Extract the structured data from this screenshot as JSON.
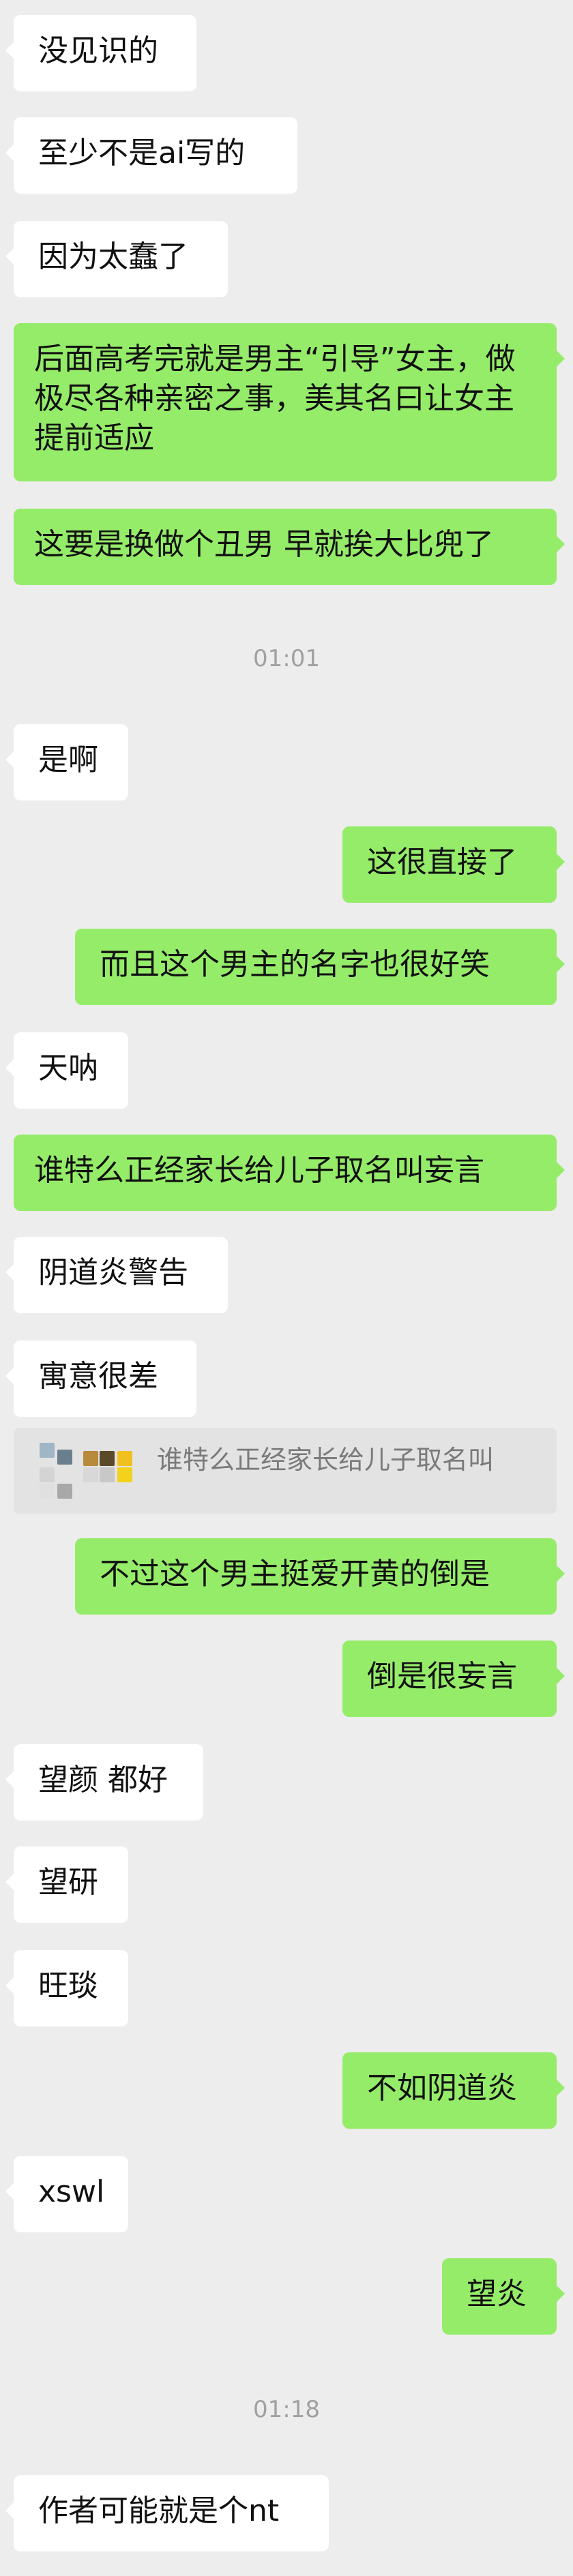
{
  "colors": {
    "background": "#ededed",
    "incoming_bubble": "#ffffff",
    "outgoing_bubble": "#95ec69",
    "timestamp": "#a0a0a0",
    "quote_background": "#e3e3e3",
    "quote_text": "#7a7a7a"
  },
  "messages": [
    {
      "side": "left",
      "text": "没见识的"
    },
    {
      "side": "left",
      "text": "至少不是ai写的"
    },
    {
      "side": "left",
      "text": "因为太蠢了"
    },
    {
      "side": "right",
      "text": "后面高考完就是男主“引导”女主，做极尽各种亲密之事，美其名曰让女主提前适应"
    },
    {
      "side": "right",
      "text": "这要是换做个丑男 早就挨大比兜了"
    },
    {
      "time": "01:01"
    },
    {
      "side": "left",
      "text": "是啊"
    },
    {
      "side": "right",
      "text": "这很直接了"
    },
    {
      "side": "right",
      "text": "而且这个男主的名字也很好笑"
    },
    {
      "side": "left",
      "text": "天呐"
    },
    {
      "side": "right",
      "text": "谁特么正经家长给儿子取名叫妄言"
    },
    {
      "side": "left",
      "text": "阴道炎警告"
    },
    {
      "side": "left",
      "text": "寓意很差"
    },
    {
      "quote": "谁特么正经家长给儿子取名叫"
    },
    {
      "side": "right",
      "text": "不过这个男主挺爱开黄的倒是"
    },
    {
      "side": "right",
      "text": "倒是很妄言"
    },
    {
      "side": "left",
      "text": "望颜 都好"
    },
    {
      "side": "left",
      "text": "望研"
    },
    {
      "side": "left",
      "text": "旺琰"
    },
    {
      "side": "right",
      "text": "不如阴道炎"
    },
    {
      "side": "left",
      "text": "xswl"
    },
    {
      "side": "right",
      "text": "望炎"
    },
    {
      "time": "01:18"
    },
    {
      "side": "left",
      "text": "作者可能就是个nt"
    }
  ]
}
